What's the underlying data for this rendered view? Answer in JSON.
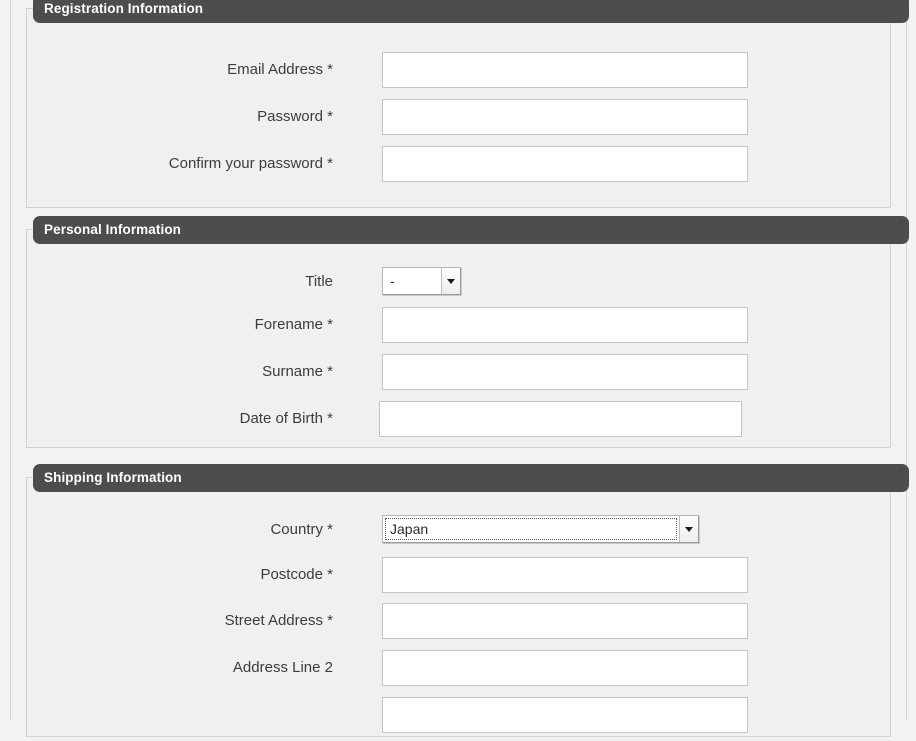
{
  "theme": {
    "page_background": "#f2f2f2",
    "section_background": "#f0f0f0",
    "section_header_background": "#4d4d4d",
    "section_header_text": "#ffffff",
    "label_text": "#3c3c3c",
    "input_background": "#ffffff",
    "input_border": "#c4c4c4"
  },
  "sections": [
    {
      "title": "Registration Information",
      "rows": [
        {
          "label": "Email Address *",
          "type": "text",
          "value": "",
          "placeholder": ""
        },
        {
          "label": "Password *",
          "type": "text",
          "value": "",
          "placeholder": ""
        },
        {
          "label": "Confirm your password *",
          "type": "text",
          "value": "",
          "placeholder": ""
        }
      ]
    },
    {
      "title": "Personal Information",
      "rows": [
        {
          "label": "Title",
          "type": "select",
          "value": "-",
          "focused": false
        },
        {
          "label": "Forename *",
          "type": "text",
          "value": "",
          "placeholder": ""
        },
        {
          "label": "Surname *",
          "type": "text",
          "value": "",
          "placeholder": ""
        },
        {
          "label": "Date of Birth *",
          "type": "text",
          "value": "",
          "placeholder": ""
        }
      ]
    },
    {
      "title": "Shipping Information",
      "rows": [
        {
          "label": "Country *",
          "type": "select",
          "value": "Japan",
          "focused": true
        },
        {
          "label": "Postcode *",
          "type": "text",
          "value": "",
          "placeholder": ""
        },
        {
          "label": "Street Address *",
          "type": "text",
          "value": "",
          "placeholder": ""
        },
        {
          "label": "Address Line 2",
          "type": "text",
          "value": "",
          "placeholder": ""
        },
        {
          "label": "",
          "type": "text",
          "value": "",
          "placeholder": ""
        }
      ]
    }
  ]
}
